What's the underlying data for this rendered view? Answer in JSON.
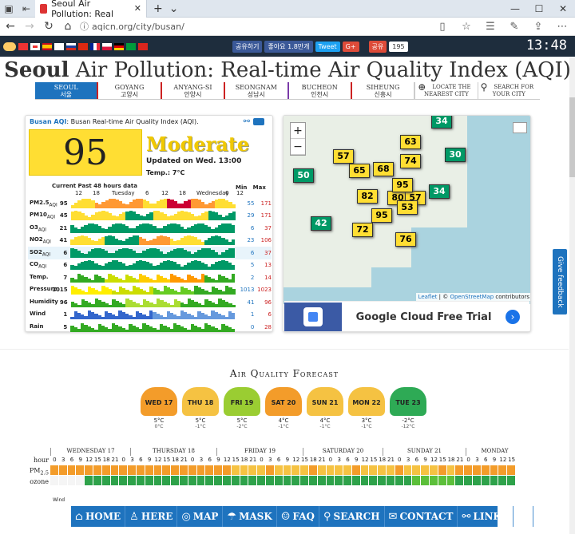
{
  "browser": {
    "tab_title": "Seoul Air Pollution: Real",
    "url": "aqicn.org/city/busan/",
    "new_tab": "+"
  },
  "topstrip": {
    "share1": "공유하기",
    "share2": "좋아요 1.8만개",
    "share3": "Tweet",
    "share4": "G+",
    "share5": "공유",
    "count": "195",
    "clock": "13:48"
  },
  "title": {
    "bold": "Seoul",
    "rest": " Air Pollution: Real-time Air Quality Index (AQI)"
  },
  "cities": [
    {
      "en": "SEOUL",
      "ko": "서울"
    },
    {
      "en": "GOYANG",
      "ko": "고양시"
    },
    {
      "en": "ANYANG-SI",
      "ko": "안양시"
    },
    {
      "en": "SEONGNAM",
      "ko": "성남시"
    },
    {
      "en": "BUCHEON",
      "ko": "인천시"
    },
    {
      "en": "SIHEUNG",
      "ko": "신흥시"
    },
    {
      "en": "LOCATE THE",
      "ko": "NEAREST CITY"
    },
    {
      "en": "SEARCH FOR",
      "ko": "YOUR CITY"
    }
  ],
  "aqi": {
    "title_city": "Busan AQI",
    "title_rest": ": Busan Real-time Air Quality Index (AQI).",
    "value": "95",
    "level": "Moderate",
    "updated": "Updated on Wed. 13:00",
    "temp": "Temp.: 7°C",
    "hist_header": "Current Past 48 hours data",
    "min_label": "Min",
    "max_label": "Max",
    "hour_ticks": [
      "12",
      "18",
      "Tuesday",
      "6",
      "12",
      "18",
      "Wednesday",
      "6",
      "12"
    ],
    "rows": [
      {
        "label": "PM2.5",
        "sub": "AQI",
        "cur": "95",
        "min": "55",
        "max": "171"
      },
      {
        "label": "PM10",
        "sub": "AQI",
        "cur": "45",
        "min": "29",
        "max": "171"
      },
      {
        "label": "O3",
        "sub": "AQI",
        "cur": "21",
        "min": "6",
        "max": "37"
      },
      {
        "label": "NO2",
        "sub": "AQI",
        "cur": "41",
        "min": "23",
        "max": "106"
      },
      {
        "label": "SO2",
        "sub": "AQI",
        "cur": "6",
        "min": "6",
        "max": "37"
      },
      {
        "label": "CO",
        "sub": "AQI",
        "cur": "6",
        "min": "5",
        "max": "13"
      },
      {
        "label": "Temp.",
        "sub": "",
        "cur": "7",
        "min": "2",
        "max": "14"
      },
      {
        "label": "Pressure",
        "sub": "",
        "cur": "1015",
        "min": "1013",
        "max": "1023"
      },
      {
        "label": "Humidity",
        "sub": "",
        "cur": "96",
        "min": "41",
        "max": "96"
      },
      {
        "label": "Wind",
        "sub": "",
        "cur": "1",
        "min": "1",
        "max": "6"
      },
      {
        "label": "Rain",
        "sub": "",
        "cur": "5",
        "min": "0",
        "max": "28"
      }
    ]
  },
  "map": {
    "zoom_in": "+",
    "zoom_out": "−",
    "markers": [
      "34",
      "57",
      "63",
      "74",
      "30",
      "65",
      "68",
      "50",
      "34",
      "82",
      "80",
      "57",
      "95",
      "53",
      "42",
      "95",
      "72",
      "76"
    ],
    "attribution_leaflet": "Leaflet",
    "attribution_rest": " | © ",
    "attribution_osm": "OpenStreetMap",
    "attribution_end": " contributors",
    "ad_text": "Google Cloud Free Trial"
  },
  "feedback": "Give feedback",
  "forecast": {
    "title": "Air Quality Forecast",
    "days": [
      {
        "d": "WED 17",
        "hi": "5°C",
        "lo": "0°C",
        "color": "#f39c2a"
      },
      {
        "d": "THU 18",
        "hi": "5°C",
        "lo": "-1°C",
        "color": "#f5c242"
      },
      {
        "d": "FRI 19",
        "hi": "5°C",
        "lo": "-2°C",
        "color": "#9acd32"
      },
      {
        "d": "SAT 20",
        "hi": "4°C",
        "lo": "-1°C",
        "color": "#f39c2a"
      },
      {
        "d": "SUN 21",
        "hi": "4°C",
        "lo": "-1°C",
        "color": "#f5c242"
      },
      {
        "d": "MON 22",
        "hi": "3°C",
        "lo": "-1°C",
        "color": "#f5c242"
      },
      {
        "d": "TUE 23",
        "hi": "-2°C",
        "lo": "-12°C",
        "color": "#2eaa55"
      }
    ],
    "grid_days": [
      "WEDNESDAY 17",
      "THURSDAY 18",
      "FRIDAY 19",
      "SATURDAY 20",
      "SUNDAY 21",
      "MONDAY"
    ],
    "hours": [
      "0",
      "3",
      "6",
      "9",
      "12",
      "15",
      "18",
      "21"
    ],
    "row_hour": "hour",
    "row_pm": "PM",
    "row_pm_sub": "2.5",
    "row_ozone": "ozone",
    "row_wind": "Wind"
  },
  "bottomnav": [
    {
      "icon": "⌂",
      "label": "HOME"
    },
    {
      "icon": "♙",
      "label": "HERE"
    },
    {
      "icon": "◎",
      "label": "MAP"
    },
    {
      "icon": "☂",
      "label": "MASK"
    },
    {
      "icon": "☺",
      "label": "FAQ"
    },
    {
      "icon": "⚲",
      "label": "SEARCH"
    },
    {
      "icon": "✉",
      "label": "CONTACT"
    },
    {
      "icon": "⚯",
      "label": "LINKS"
    },
    {
      "icon": "⚙",
      "label": ""
    }
  ]
}
